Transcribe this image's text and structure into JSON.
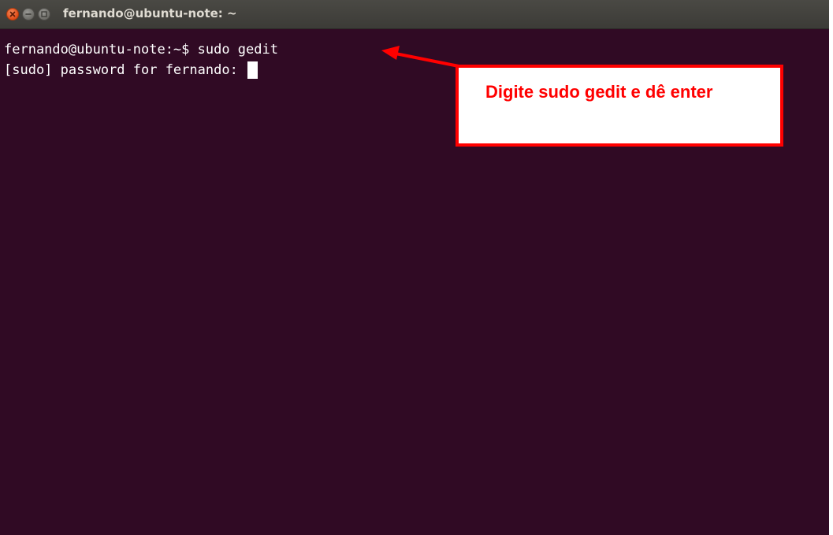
{
  "window": {
    "title": "fernando@ubuntu-note: ~",
    "controls": {
      "close": "close-icon",
      "minimize": "minimize-icon",
      "maximize": "maximize-icon"
    }
  },
  "terminal": {
    "lines": [
      "fernando@ubuntu-note:~$ sudo gedit",
      "[sudo] password for fernando: "
    ],
    "cursor": "block"
  },
  "annotation": {
    "text": "Digite sudo gedit e dê enter",
    "color": "#ff0000"
  },
  "colors": {
    "terminal_bg": "#300a24",
    "titlebar_bg": "#3c3b37",
    "close_button": "#df4a16"
  }
}
